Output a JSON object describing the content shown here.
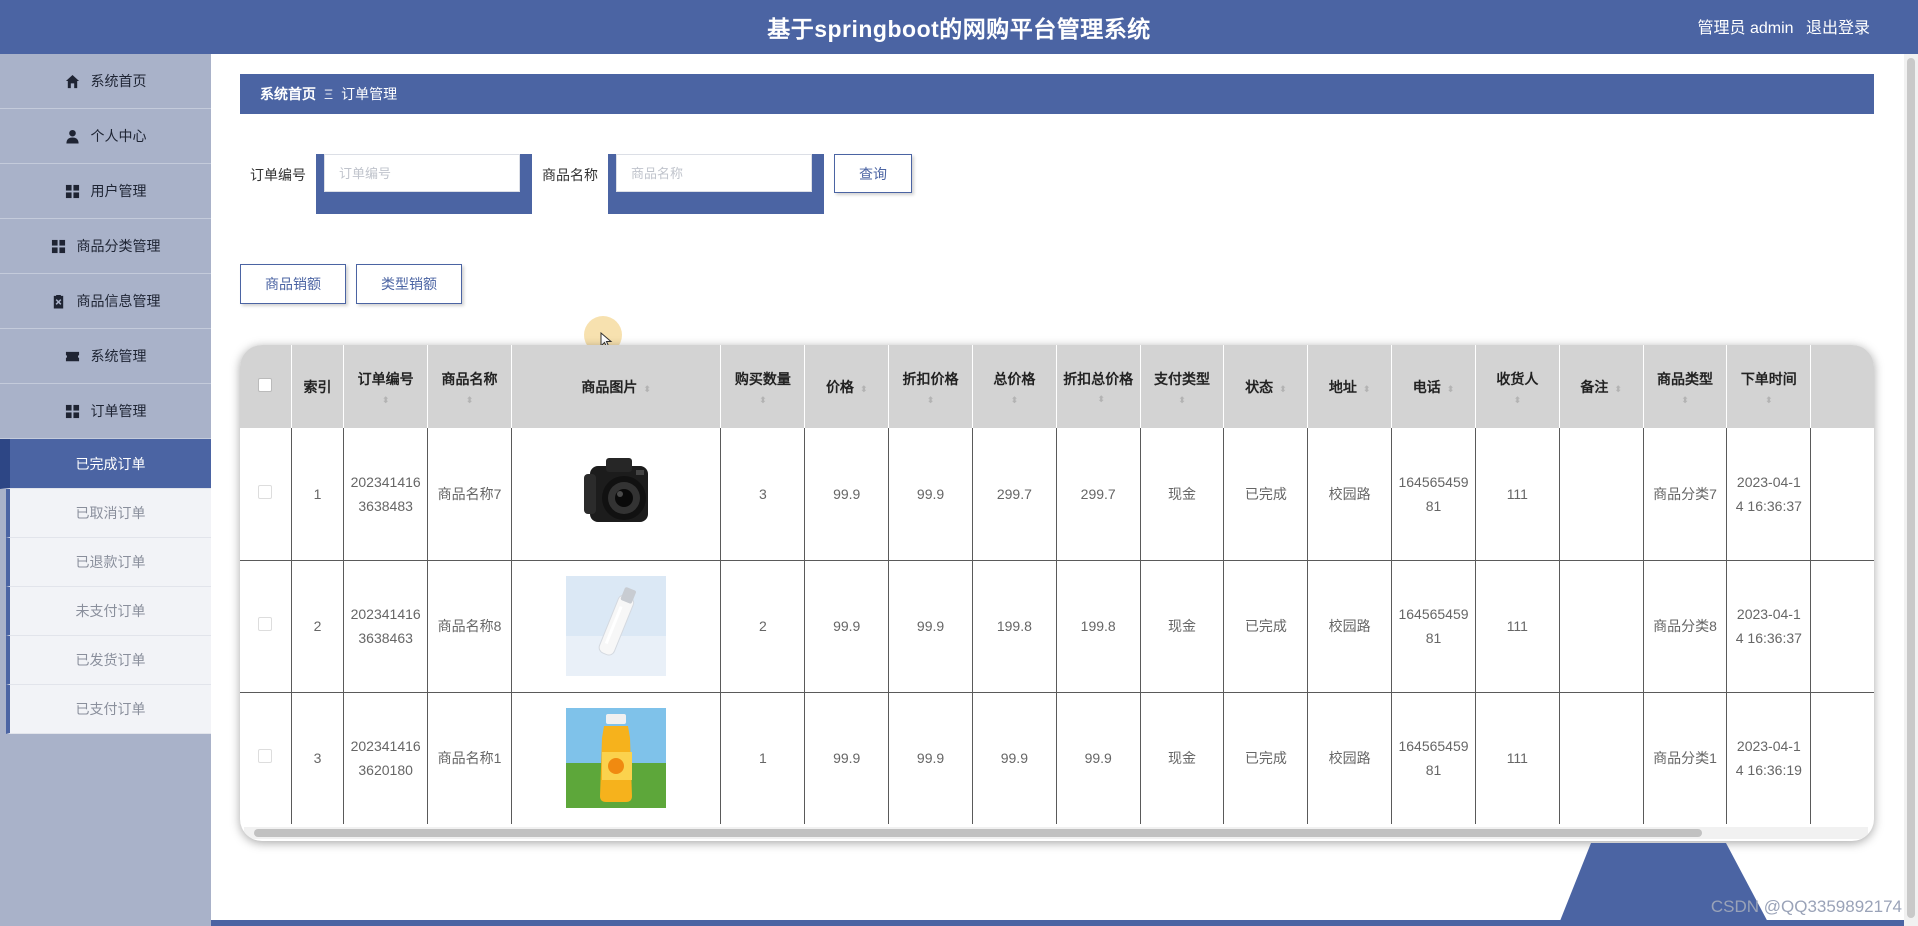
{
  "header": {
    "title": "基于springboot的网购平台管理系统",
    "user_label": "管理员 admin",
    "logout_label": "退出登录"
  },
  "sidebar": {
    "items": [
      {
        "label": "系统首页",
        "icon": "home-icon"
      },
      {
        "label": "个人中心",
        "icon": "user-icon"
      },
      {
        "label": "用户管理",
        "icon": "grid-icon"
      },
      {
        "label": "商品分类管理",
        "icon": "grid-icon"
      },
      {
        "label": "商品信息管理",
        "icon": "clipboard-icon"
      },
      {
        "label": "系统管理",
        "icon": "ticket-icon"
      },
      {
        "label": "订单管理",
        "icon": "grid-icon"
      }
    ],
    "order_subitems": [
      {
        "label": "已完成订单",
        "active": true
      },
      {
        "label": "已取消订单"
      },
      {
        "label": "已退款订单"
      },
      {
        "label": "未支付订单"
      },
      {
        "label": "已发货订单"
      },
      {
        "label": "已支付订单"
      }
    ]
  },
  "breadcrumb": {
    "home": "系统首页",
    "separator": "Ξ",
    "current": "订单管理"
  },
  "search": {
    "order_no_label": "订单编号",
    "order_no_placeholder": "订单编号",
    "order_no_value": "",
    "product_name_label": "商品名称",
    "product_name_placeholder": "商品名称",
    "product_name_value": "",
    "query_button": "查询"
  },
  "actions": {
    "product_sales": "商品销额",
    "type_sales": "类型销额"
  },
  "table": {
    "columns": [
      "索引",
      "订单编号",
      "商品名称",
      "商品图片",
      "购买数量",
      "价格",
      "折扣价格",
      "总价格",
      "折扣总价格",
      "支付类型",
      "状态",
      "地址",
      "电话",
      "收货人",
      "备注",
      "商品类型",
      "下单时间"
    ],
    "rows": [
      {
        "index": "1",
        "order_no": "2023414163638483",
        "name": "商品名称7",
        "image": "camera",
        "qty": "3",
        "price": "99.9",
        "discount_price": "99.9",
        "total": "299.7",
        "discount_total": "299.7",
        "pay_type": "现金",
        "status": "已完成",
        "address": "校园路",
        "phone": "16456545981",
        "receiver": "111",
        "remark": "",
        "category": "商品分类7",
        "order_time": "2023-04-14 16:36:37"
      },
      {
        "index": "2",
        "order_no": "2023414163638463",
        "name": "商品名称8",
        "image": "serum-bottle",
        "qty": "2",
        "price": "99.9",
        "discount_price": "99.9",
        "total": "199.8",
        "discount_total": "199.8",
        "pay_type": "现金",
        "status": "已完成",
        "address": "校园路",
        "phone": "16456545981",
        "receiver": "111",
        "remark": "",
        "category": "商品分类8",
        "order_time": "2023-04-14 16:36:37"
      },
      {
        "index": "3",
        "order_no": "2023414163620180",
        "name": "商品名称1",
        "image": "juice-bottle",
        "qty": "1",
        "price": "99.9",
        "discount_price": "99.9",
        "total": "99.9",
        "discount_total": "99.9",
        "pay_type": "现金",
        "status": "已完成",
        "address": "校园路",
        "phone": "16456545981",
        "receiver": "111",
        "remark": "",
        "category": "商品分类1",
        "order_time": "2023-04-14 16:36:19"
      }
    ]
  },
  "watermark": "CSDN @QQ3359892174",
  "colors": {
    "primary": "#4b64a3",
    "sidebar": "#a9b2c9",
    "table_header": "#d3d3d3"
  }
}
